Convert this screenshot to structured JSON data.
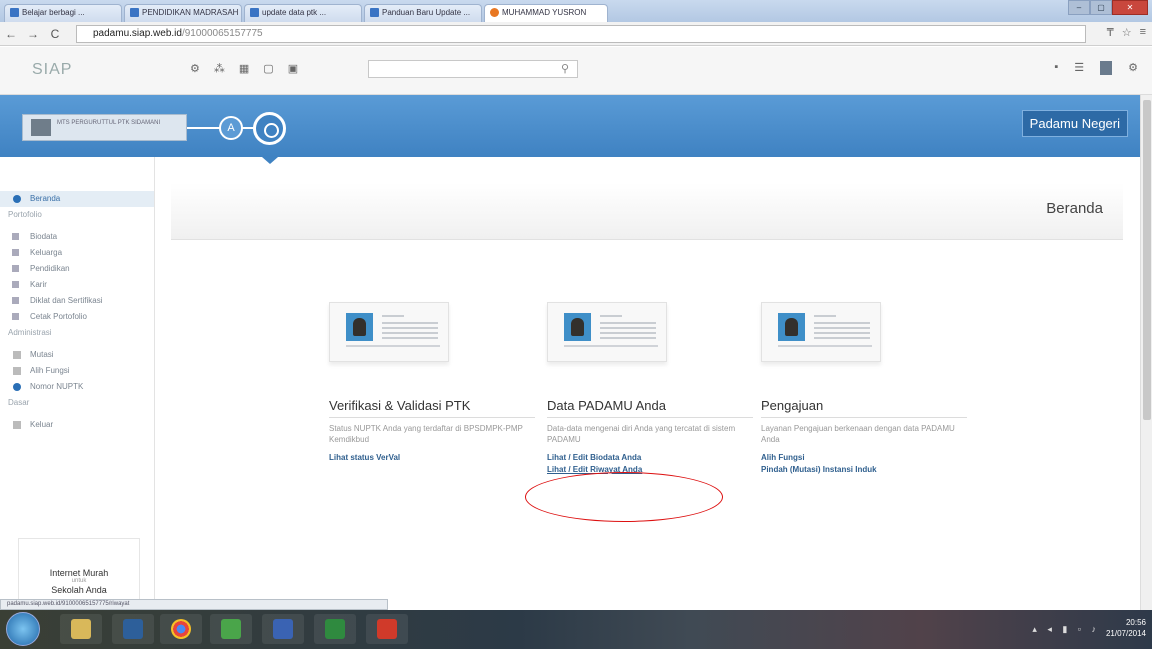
{
  "browser": {
    "tabs": [
      "Belajar berbagi ...",
      "PENDIDIKAN MADRASAH ...",
      "update data ptk ...",
      "Panduan Baru Update ...",
      "MUHAMMAD YUSRON"
    ],
    "active_tab": 4,
    "url_host": "padamu.siap.web.id",
    "url_path": "/91000065157775",
    "window_controls": [
      "–",
      "▢",
      "✕"
    ]
  },
  "siap": {
    "logo": "SIAP",
    "search": {
      "placeholder": ""
    }
  },
  "header": {
    "school": "MTS PERGURUTTUL PTK SIDAMANI",
    "step_a": "A",
    "brand": "Padamu Negeri"
  },
  "sidebar": {
    "home": "Beranda",
    "section_portfolio": "Portofolio",
    "portfolio_items": [
      "Biodata",
      "Keluarga",
      "Pendidikan",
      "Karir",
      "Diklat dan Sertifikasi",
      "Cetak Portofolio"
    ],
    "section_admin": "Administrasi",
    "admin_items": [
      "Mutasi",
      "Alih Fungsi",
      "Nomor NUPTK"
    ],
    "section_other": "Dasar",
    "logout": "Keluar",
    "ad_title": "Internet Murah",
    "ad_small": "untuk",
    "ad_sub": "Sekolah Anda"
  },
  "main": {
    "page_title": "Beranda",
    "cards": [
      {
        "title": "Verifikasi & Validasi PTK",
        "desc": "Status NUPTK Anda yang terdaftar di BPSDMPK-PMP Kemdikbud",
        "links": [
          "Lihat status VerVal"
        ]
      },
      {
        "title": "Data PADAMU Anda",
        "desc": "Data-data mengenai diri Anda yang tercatat di sistem PADAMU",
        "links": [
          "Lihat / Edit Biodata Anda",
          "Lihat / Edit Riwayat Anda"
        ]
      },
      {
        "title": "Pengajuan",
        "desc": "Layanan Pengajuan berkenaan dengan data PADAMU Anda",
        "links": [
          "Alih Fungsi",
          "Pindah (Mutasi) Instansi Induk"
        ]
      }
    ]
  },
  "status_url": "padamu.siap.web.id/91000065157775/riwayat",
  "taskbar": {
    "time": "20:56",
    "date": "21/07/2014"
  }
}
